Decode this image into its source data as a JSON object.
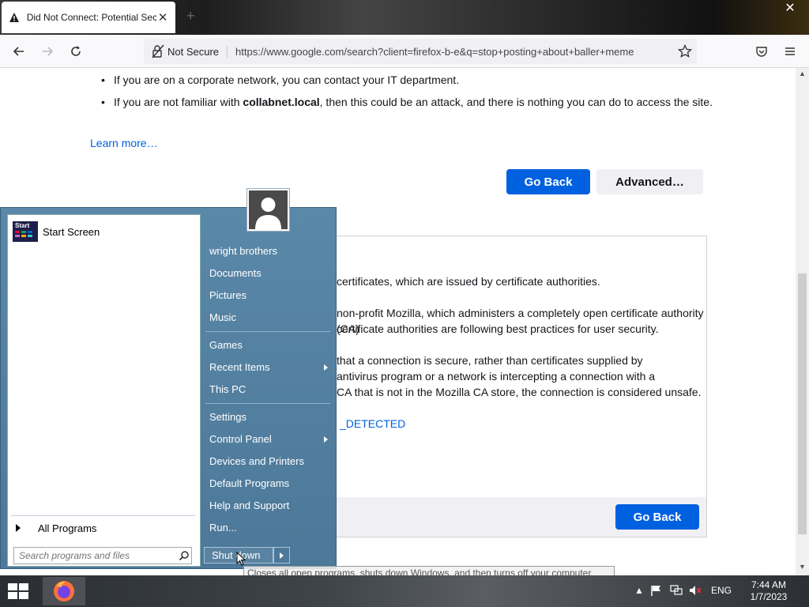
{
  "browser": {
    "tab_title": "Did Not Connect: Potential Security Issue",
    "tab_close": "✕",
    "new_tab": "+",
    "window_close": "✕",
    "not_secure": "Not Secure",
    "url": "https://www.google.com/search?client=firefox-b-e&q=stop+posting+about+baller+meme"
  },
  "page": {
    "bullets": [
      "If you are on a corporate network, you can contact your IT department.",
      {
        "pre": "If you are not familiar with ",
        "bold": "collabnet.local",
        "post": ", then this could be an attack, and there is nothing you can do to access the site."
      }
    ],
    "learn_more": "Learn more…",
    "go_back": "Go Back",
    "advanced": "Advanced…",
    "adv_lines": [
      "certificates, which are issued by certificate authorities.",
      "non-profit Mozilla, which administers a completely open certificate authority (CA)",
      "certificate authorities are following best practices for user security.",
      "that a connection is secure, rather than certificates supplied by",
      "antivirus program or a network is intercepting a connection with a",
      "CA that is not in the Mozilla CA store, the connection is considered unsafe."
    ],
    "error_code": "_DETECTED",
    "go_back_2": "Go Back"
  },
  "start_menu": {
    "start_screen": "Start Screen",
    "start_thumb_label": "Start",
    "all_programs": "All Programs",
    "search_placeholder": "Search programs and files",
    "items": {
      "user": "wright brothers",
      "documents": "Documents",
      "pictures": "Pictures",
      "music": "Music",
      "games": "Games",
      "recent_items": "Recent Items",
      "this_pc": "This PC",
      "settings": "Settings",
      "control_panel": "Control Panel",
      "devices_printers": "Devices and Printers",
      "default_programs": "Default Programs",
      "help_support": "Help and Support",
      "run": "Run..."
    },
    "shut_down": "Shut down",
    "tooltip": "Closes all open programs, shuts down Windows, and then turns off your computer."
  },
  "taskbar": {
    "language": "ENG",
    "time": "7:44 AM",
    "date": "1/7/2023"
  }
}
